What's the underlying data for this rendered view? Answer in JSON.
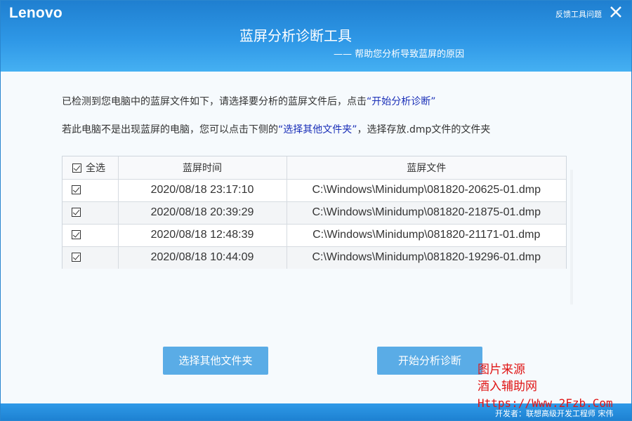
{
  "app": {
    "brand": "Lenovo",
    "feedback_link": "反馈工具问题",
    "title": "蓝屏分析诊断工具",
    "subtitle": "—— 帮助您分析导致蓝屏的原因"
  },
  "instructions": {
    "line1_prefix": "已检测到您电脑中的蓝屏文件如下，请选择要分析的蓝屏文件后，点击",
    "line1_link": "“开始分析诊断”",
    "line2_prefix": "若此电脑不是出现蓝屏的电脑，您可以点击下侧的",
    "line2_link": "“选择其他文件夹”",
    "line2_suffix": "，选择存放.dmp文件的文件夹"
  },
  "table": {
    "select_all_label": "全选",
    "headers": [
      "蓝屏时间",
      "蓝屏文件"
    ],
    "rows": [
      {
        "checked": true,
        "time": "2020/08/18 23:17:10",
        "file": "C:\\Windows\\Minidump\\081820-20625-01.dmp"
      },
      {
        "checked": true,
        "time": "2020/08/18 20:39:29",
        "file": "C:\\Windows\\Minidump\\081820-21875-01.dmp"
      },
      {
        "checked": true,
        "time": "2020/08/18 12:48:39",
        "file": "C:\\Windows\\Minidump\\081820-21171-01.dmp"
      },
      {
        "checked": true,
        "time": "2020/08/18 10:44:09",
        "file": "C:\\Windows\\Minidump\\081820-19296-01.dmp"
      }
    ]
  },
  "buttons": {
    "choose_folder": "选择其他文件夹",
    "start_analysis": "开始分析诊断"
  },
  "footer": {
    "developer": "开发者：联想高级开发工程师 宋伟"
  },
  "watermark": {
    "line1": "图片来源",
    "line2": "酒入辅助网",
    "line3": "Https://Www.2Fzb.Com"
  },
  "icons": {
    "close": "close-icon",
    "checkbox": "checkbox-checked-icon"
  },
  "colors": {
    "header_blue": "#2e97e6",
    "button_blue": "#5aace6",
    "link_blue": "#1a2fb8",
    "watermark_red": "#e01515"
  }
}
